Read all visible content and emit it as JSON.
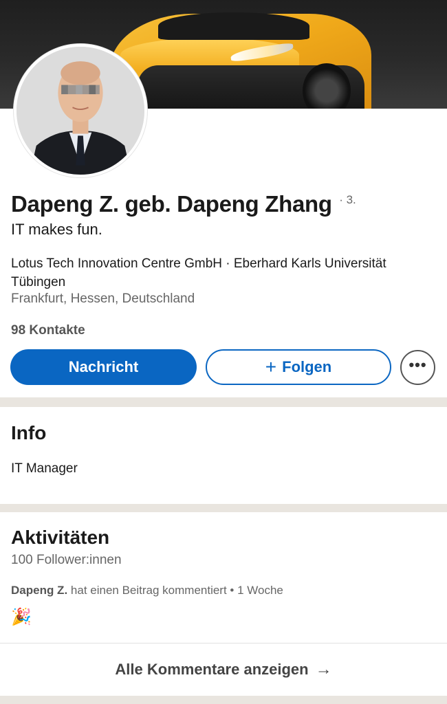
{
  "profile": {
    "name": "Dapeng Z. geb. Dapeng Zhang",
    "degree": "· 3.",
    "headline": "IT makes fun.",
    "organizations": "Lotus Tech Innovation Centre GmbH · Eberhard Karls Universität Tübingen",
    "location": "Frankfurt, Hessen, Deutschland",
    "connections": "98 Kontakte"
  },
  "actions": {
    "message_label": "Nachricht",
    "follow_plus": "+",
    "follow_label": "Folgen",
    "more_label": "•••"
  },
  "info": {
    "title": "Info",
    "text": "IT Manager"
  },
  "activity": {
    "title": "Aktivitäten",
    "followers": "100 Follower:innen",
    "post_actor": "Dapeng Z.",
    "post_text": "hat einen Beitrag kommentiert • 1 Woche",
    "post_emoji": "🎉",
    "show_all_label": "Alle Kommentare anzeigen",
    "show_all_arrow": "→"
  },
  "colors": {
    "primary": "#0a66c2",
    "page_background": "#e9e5df",
    "banner_car": "#f0a91a"
  },
  "icons": {
    "more": "more-dots-icon",
    "arrow": "arrow-right-icon",
    "emoji": "party-popper-icon"
  }
}
